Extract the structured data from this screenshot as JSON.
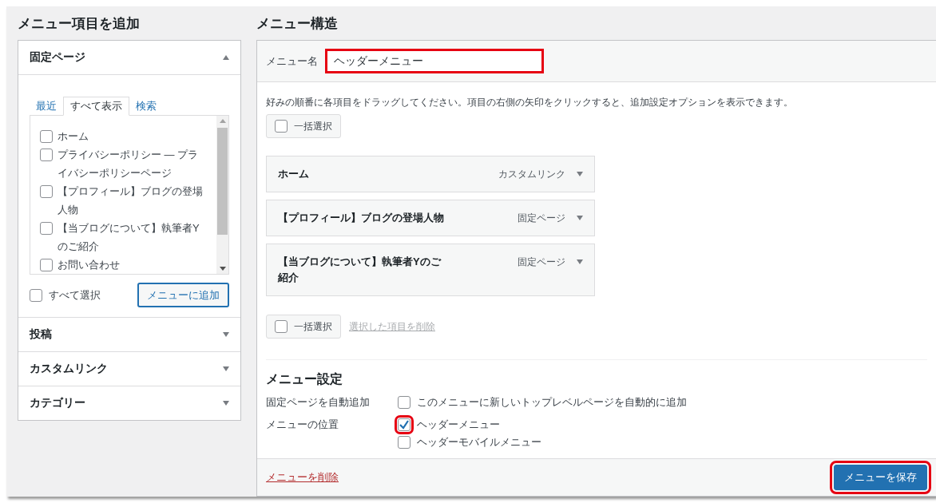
{
  "add_items": {
    "title": "メニュー項目を追加",
    "sections": [
      {
        "title": "固定ページ",
        "expanded": true,
        "tabs": [
          {
            "label": "最近",
            "selected": false
          },
          {
            "label": "すべて表示",
            "selected": true
          },
          {
            "label": "検索",
            "selected": false
          }
        ],
        "items": [
          {
            "label": "ホーム",
            "checked": false
          },
          {
            "label": "プライバシーポリシー — プライバシーポリシーページ",
            "checked": false
          },
          {
            "label": "【プロフィール】ブログの登場人物",
            "checked": false
          },
          {
            "label": "【当ブログについて】執筆者Yのご紹介",
            "checked": false
          },
          {
            "label": "お問い合わせ",
            "checked": false
          }
        ],
        "select_all": {
          "label": "すべて選択",
          "checked": false
        },
        "add_button": "メニューに追加"
      },
      {
        "title": "投稿",
        "expanded": false
      },
      {
        "title": "カスタムリンク",
        "expanded": false
      },
      {
        "title": "カテゴリー",
        "expanded": false
      }
    ]
  },
  "structure": {
    "title": "メニュー構造",
    "menu_name": {
      "label": "メニュー名",
      "value": "ヘッダーメニュー",
      "highlighted": true
    },
    "instructions": "好みの順番に各項目をドラッグしてください。項目の右側の矢印をクリックすると、追加設定オプションを表示できます。",
    "bulk_select_top": {
      "label": "一括選択",
      "checked": false
    },
    "menu_items": [
      {
        "title": "ホーム",
        "type": "カスタムリンク"
      },
      {
        "title": "【プロフィール】ブログの登場人物",
        "type": "固定ページ"
      },
      {
        "title": "【当ブログについて】執筆者Yのご紹介",
        "type": "固定ページ"
      }
    ],
    "bulk_select_bottom": {
      "label": "一括選択",
      "checked": false
    },
    "bulk_delete_link": "選択した項目を削除",
    "settings": {
      "title": "メニュー設定",
      "rows": [
        {
          "label": "固定ページを自動追加",
          "options": [
            {
              "label": "このメニューに新しいトップレベルページを自動的に追加",
              "checked": false,
              "highlighted": false
            }
          ]
        },
        {
          "label": "メニューの位置",
          "options": [
            {
              "label": "ヘッダーメニュー",
              "checked": true,
              "highlighted": true
            },
            {
              "label": "ヘッダーモバイルメニュー",
              "checked": false,
              "highlighted": false
            }
          ]
        }
      ]
    },
    "delete_link": "メニューを削除",
    "save_button": {
      "label": "メニューを保存",
      "highlighted": true
    }
  }
}
